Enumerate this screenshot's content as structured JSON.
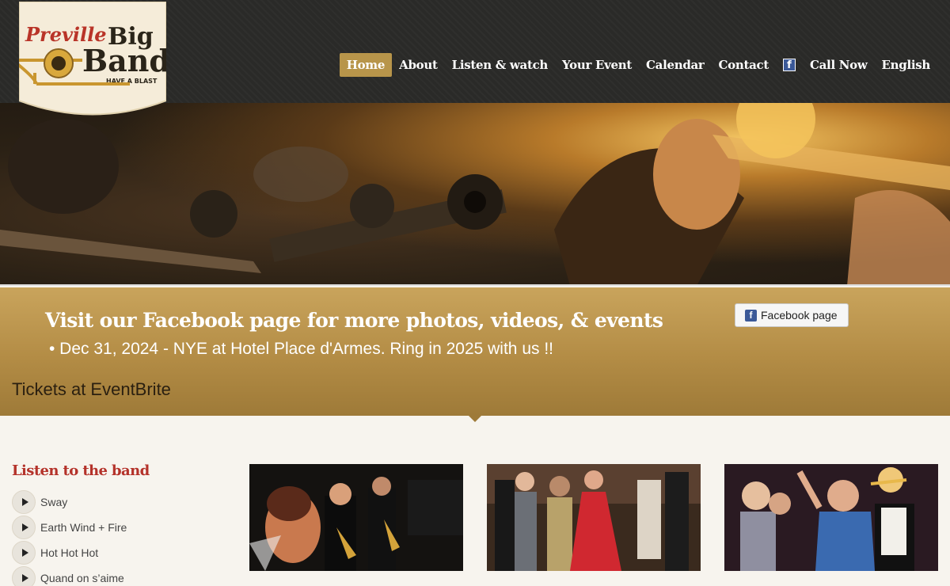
{
  "logo": {
    "line1": "Preville",
    "line2": "Big",
    "line3": "Band",
    "tagline": "HAVE A BLAST"
  },
  "nav": {
    "home": "Home",
    "about": "About",
    "listen": "Listen & watch",
    "event": "Your Event",
    "calendar": "Calendar",
    "contact": "Contact",
    "facebook_icon": "facebook-icon",
    "call": "Call Now",
    "language": "English"
  },
  "band": {
    "title": "Visit our Facebook page for more photos, videos, & events",
    "news": "• Dec 31, 2024 - NYE at Hotel Place d'Armes. Ring in 2025 with us !!",
    "tickets": "Tickets at EventBrite",
    "fb_button": "Facebook page"
  },
  "listen": {
    "title": "Listen to the band",
    "tracks": [
      "Sway",
      "Earth Wind + Fire",
      "Hot Hot Hot",
      "Quand on s’aime"
    ]
  },
  "colors": {
    "accent_gold": "#b8954a",
    "title_red": "#b4322a",
    "header_dark": "#2a2a28"
  }
}
